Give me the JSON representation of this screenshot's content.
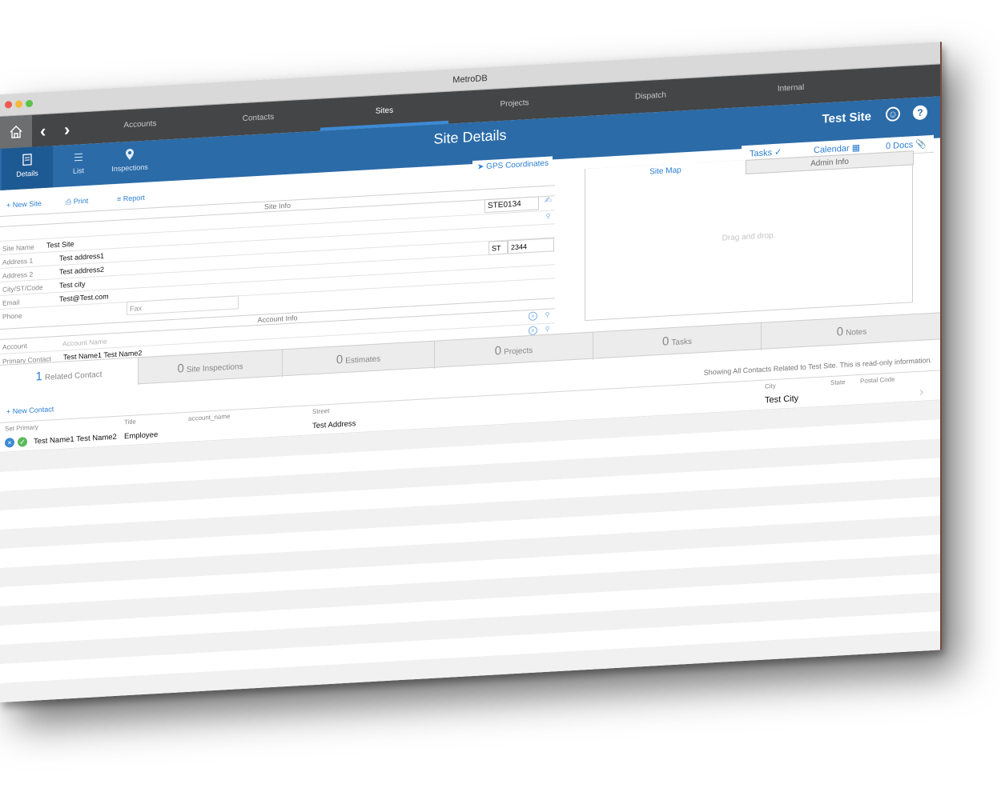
{
  "app": {
    "title": "MetroDB"
  },
  "nav": {
    "tabs": [
      "Accounts",
      "Contacts",
      "Sites",
      "Projects",
      "Dispatch",
      "Internal"
    ],
    "active_tab": "Sites"
  },
  "header": {
    "page_title": "Site Details",
    "site_name": "Test Site",
    "subnav": [
      "Details",
      "List",
      "Inspections"
    ]
  },
  "toolbar": {
    "new_site": "New Site",
    "print": "Print",
    "report": "Report",
    "gps": "GPS Coordinates",
    "tasks": "Tasks",
    "calendar": "Calendar",
    "docs": "0 Docs"
  },
  "site_info": {
    "header": "Site Info",
    "site_id": "STE0134",
    "labels": {
      "site_name": "Site Name",
      "address1": "Address 1",
      "address2": "Address 2",
      "city_st_code": "City/ST/Code",
      "email": "Email",
      "phone": "Phone",
      "fax": "Fax"
    },
    "values": {
      "site_name": "Test Site",
      "address1": "Test address1",
      "address2": "Test address2",
      "city": "Test city",
      "state": "ST",
      "code": "2344",
      "email": "Test@Test.com"
    }
  },
  "account_info": {
    "header": "Account Info",
    "account_label": "Account",
    "account_placeholder": "Account Name",
    "primary_contact_label": "Primary Contact",
    "primary_contact_value": "Test Name1 Test Name2"
  },
  "map_panel": {
    "tab_map": "Site Map",
    "tab_admin": "Admin Info",
    "drop_text": "Drag and drop."
  },
  "bottom_tabs": [
    {
      "count": "1",
      "label": "Related Contact"
    },
    {
      "count": "0",
      "label": "Site Inspections"
    },
    {
      "count": "0",
      "label": "Estimates"
    },
    {
      "count": "0",
      "label": "Projects"
    },
    {
      "count": "0",
      "label": "Tasks"
    },
    {
      "count": "0",
      "label": "Notes"
    }
  ],
  "contacts": {
    "new_contact": "New Contact",
    "showing_text": "Showing All Contacts Related to Test Site. This is read-only information.",
    "columns": [
      "Set Primary",
      "Title",
      "account_name",
      "Street",
      "City",
      "State",
      "Postal Code"
    ],
    "rows": [
      {
        "name": "Test Name1 Test Name2",
        "title": "Employee",
        "account_name": "",
        "street": "Test Address",
        "city": "Test City",
        "state": "",
        "postal_code": ""
      }
    ]
  },
  "colors": {
    "nav_dark": "#444546",
    "header_blue": "#2b6ba8",
    "accent_blue": "#2b7fd1"
  }
}
